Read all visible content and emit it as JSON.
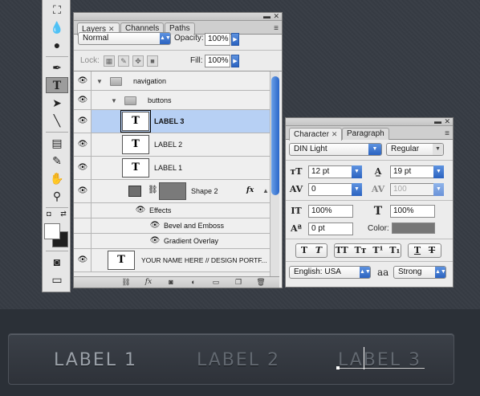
{
  "canvas": {
    "labels": [
      {
        "text": "LABEL 1"
      },
      {
        "text": "LABEL 2"
      },
      {
        "text": "LABEL 3"
      }
    ]
  },
  "tools": {
    "icons": [
      "paint-bucket-icon",
      "blur-drop-icon",
      "dodge-icon",
      "pen-icon",
      "type-icon",
      "path-select-icon",
      "line-icon",
      "notes-icon",
      "eyedropper-icon",
      "hand-icon",
      "zoom-icon"
    ],
    "selected": "type-icon"
  },
  "layers_panel": {
    "tabs": [
      {
        "label": "Layers",
        "active": true
      },
      {
        "label": "Channels"
      },
      {
        "label": "Paths"
      }
    ],
    "blend_mode": "Normal",
    "opacity_label": "Opacity:",
    "opacity_value": "100%",
    "lock_label": "Lock:",
    "fill_label": "Fill:",
    "fill_value": "100%",
    "layers": [
      {
        "name": "navigation",
        "type": "group",
        "visible": true
      },
      {
        "name": "buttons",
        "type": "group",
        "visible": true
      },
      {
        "name": "LABEL 3",
        "type": "text",
        "visible": true,
        "selected": true
      },
      {
        "name": "LABEL 2",
        "type": "text",
        "visible": true
      },
      {
        "name": "LABEL 1",
        "type": "text",
        "visible": true
      },
      {
        "name": "Shape 2",
        "type": "shape",
        "visible": true,
        "fx": "fx"
      },
      {
        "name": "Effects",
        "type": "effects"
      },
      {
        "name": "Bevel and Emboss",
        "type": "effect"
      },
      {
        "name": "Gradient Overlay",
        "type": "effect"
      },
      {
        "name": "YOUR NAME HERE  //  DESIGN PORTF...",
        "type": "text",
        "visible": true
      }
    ]
  },
  "character_panel": {
    "tabs": [
      {
        "label": "Character",
        "active": true
      },
      {
        "label": "Paragraph"
      }
    ],
    "font_family": "DIN Light",
    "font_style": "Regular",
    "font_size": "12 pt",
    "leading": "19 pt",
    "kerning": "0",
    "tracking": "100",
    "vertical_scale": "100%",
    "horizontal_scale": "100%",
    "baseline_shift": "0 pt",
    "color_label": "Color:",
    "color_value": "#767676",
    "style_buttons": [
      "T",
      "T",
      "TT",
      "Tт",
      "T¹",
      "T₁",
      "T",
      "T"
    ],
    "language": "English: USA",
    "aa_label": "aa",
    "antialias": "Strong"
  }
}
